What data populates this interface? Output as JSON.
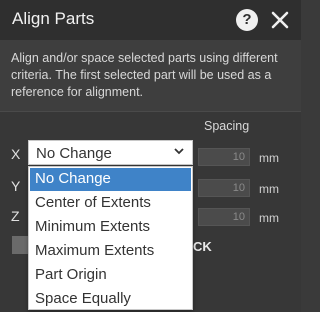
{
  "window": {
    "title": "Align Parts",
    "help_glyph": "?"
  },
  "description": "Align and/or space selected parts using different criteria. The first selected part will be used as a reference for alignment.",
  "form": {
    "spacing_header": "Spacing",
    "rows": [
      {
        "axis": "X",
        "spacing": "10",
        "unit": "mm"
      },
      {
        "axis": "Y",
        "spacing": "10",
        "unit": "mm"
      },
      {
        "axis": "Z",
        "spacing": "10",
        "unit": "mm"
      }
    ],
    "x_selected": "No Change",
    "partial_button_text": "CK"
  },
  "dropdown": {
    "options": [
      "No Change",
      "Center of Extents",
      "Minimum Extents",
      "Maximum Extents",
      "Part Origin",
      "Space Equally"
    ],
    "highlighted_index": 0
  },
  "colors": {
    "titlebar": "#2f2f2f",
    "panel": "#3b3b3b",
    "highlight": "#3f83c8"
  }
}
